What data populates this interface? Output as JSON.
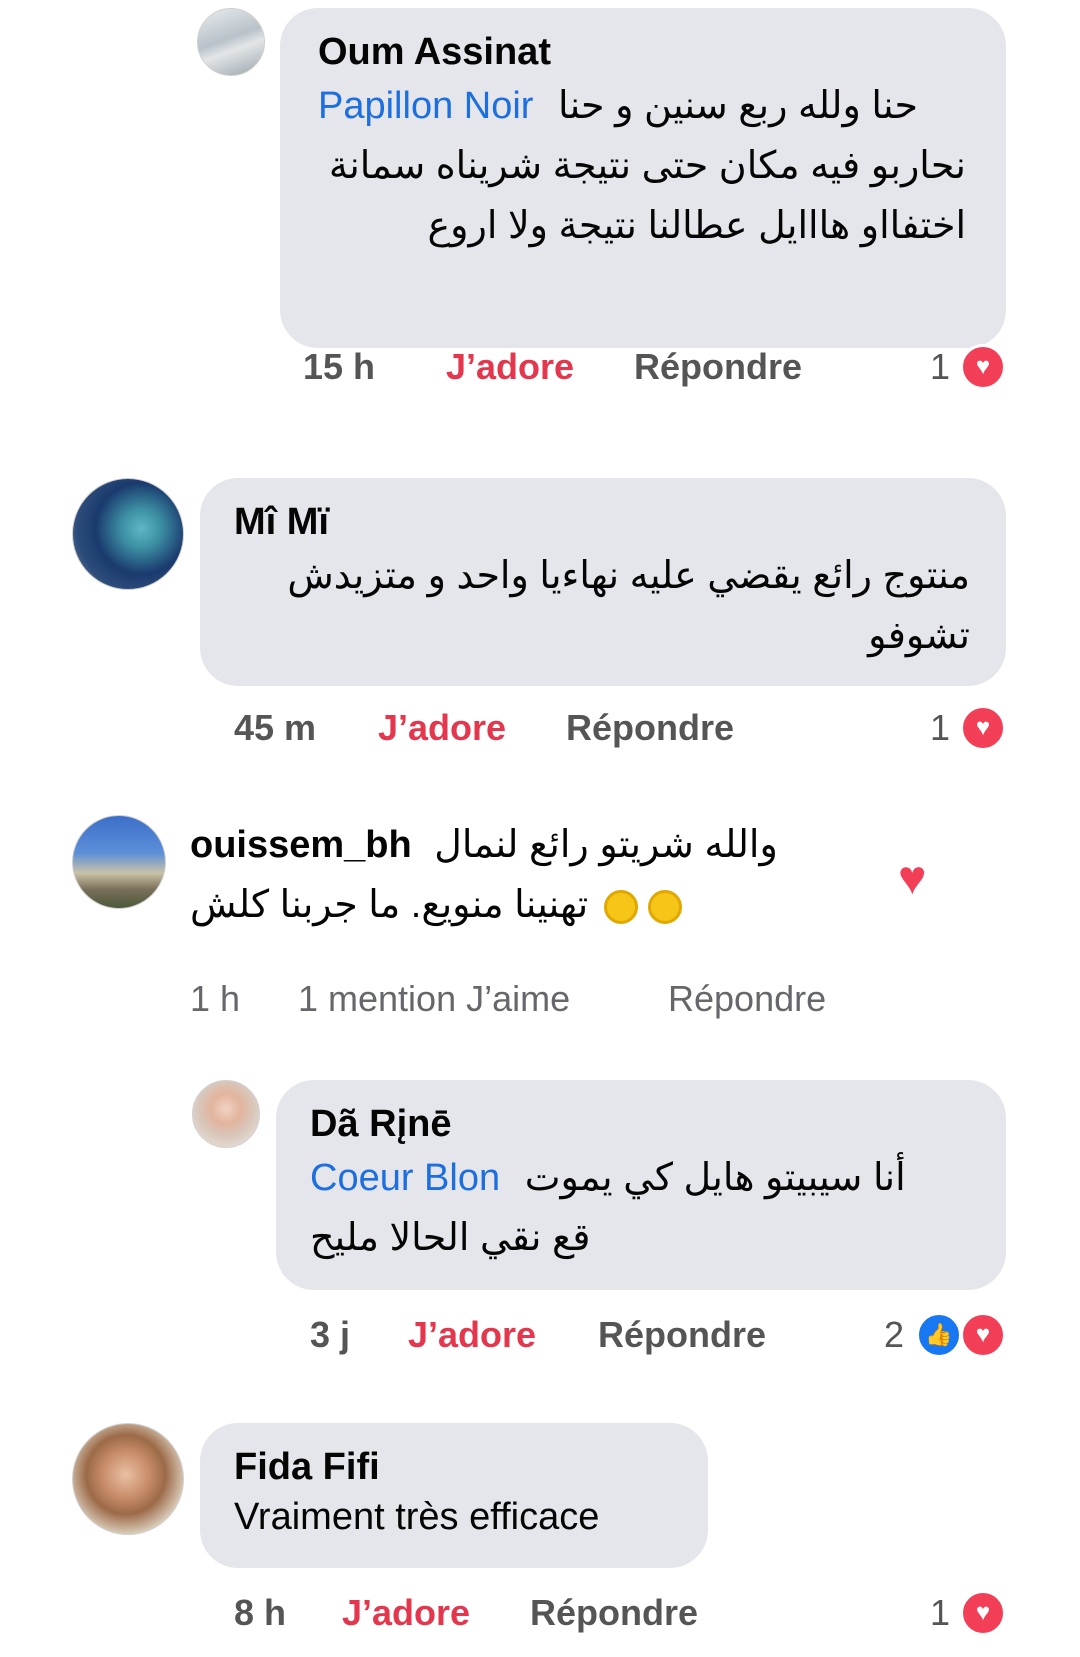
{
  "comments": [
    {
      "author": "Oum Assinat",
      "mention": "Papillon Noir",
      "text_line1": "حنا ولله ربع سنين و حنا",
      "text_rest": "نحاربو فيه مكان حتى نتيجة شريناه سمانة اختفااو هااايل عطالنا نتيجة ولا اروع",
      "time": "15 h",
      "like_label": "J’adore",
      "reply_label": "Répondre",
      "reaction_count": "1",
      "reaction_icons": [
        "heart-icon"
      ]
    },
    {
      "author": "Mî Mï",
      "text": "منتوج رائع يقضي عليه نهاءيا واحد و متزيدش تشوفو",
      "time": "45 m",
      "like_label": "J’adore",
      "reply_label": "Répondre",
      "reaction_count": "1",
      "reaction_icons": [
        "heart-icon"
      ]
    },
    {
      "author": "ouissem_bh",
      "text_line1": "والله شريتو رائع لنمال",
      "text_line2": "تهنينا منويع. ما جربنا كلش",
      "emojis": [
        "ok-hand-emoji",
        "ok-hand-emoji"
      ],
      "time": "1 h",
      "likes_mention": "1 mention J’aime",
      "reply_label": "Répondre",
      "side_reaction": "heart-icon"
    },
    {
      "author": "Dã Rįnē",
      "mention": "Coeur Blon",
      "text_line1": "أنا سيبيتو هايل كي يموت",
      "text_line2": "قع نقي الحالا مليح",
      "time": "3 j",
      "like_label": "J’adore",
      "reply_label": "Répondre",
      "reaction_count": "2",
      "reaction_icons": [
        "thumbs-up-icon",
        "heart-icon"
      ]
    },
    {
      "author": "Fida Fifi",
      "text": "Vraiment très efficace",
      "time": "8 h",
      "like_label": "J’adore",
      "reply_label": "Répondre",
      "reaction_count": "1",
      "reaction_icons": [
        "heart-icon"
      ]
    }
  ],
  "colors": {
    "bubble": "#e4e6eb",
    "like_red": "#e4374e",
    "mention_blue": "#1d6fe0",
    "heart": "#f33e58",
    "thumbs_blue": "#1877f2"
  }
}
